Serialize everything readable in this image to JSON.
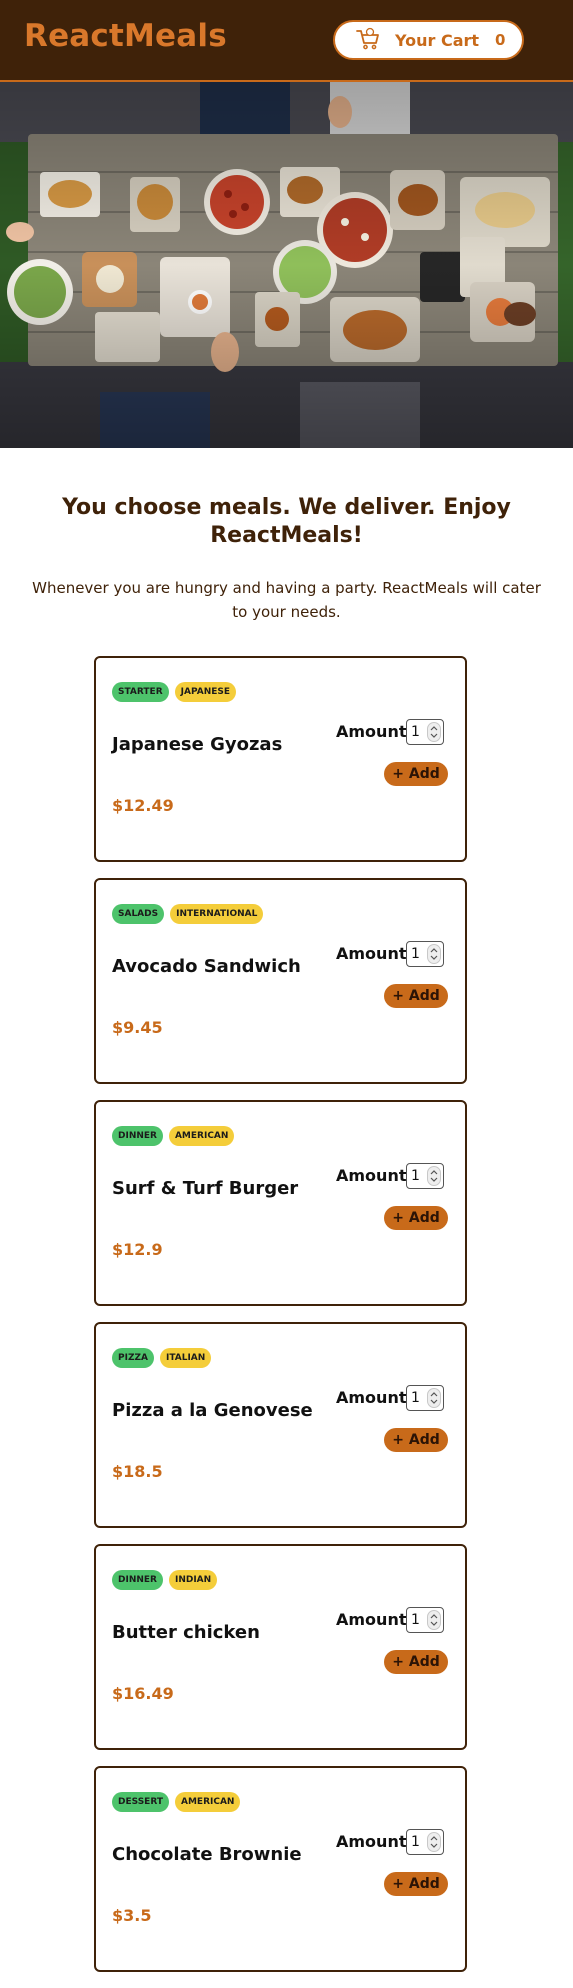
{
  "header": {
    "brand": "ReactMeals",
    "cart_label": "Your Cart",
    "cart_count": "0",
    "cart_icon": "shopping-cart-icon"
  },
  "hero": {
    "image": "food-table-hero-image"
  },
  "intro": {
    "title": "You choose meals. We deliver. Enjoy ReactMeals!",
    "text": "Whenever you are hungry and having a party. ReactMeals will cater to your needs."
  },
  "meals": [
    {
      "category": "STARTER",
      "cuisine": "JAPANESE",
      "name": "Japanese Gyozas",
      "price": "$12.49",
      "amount_label": "Amount",
      "amount": "1",
      "add_label": "+ Add"
    },
    {
      "category": "SALADS",
      "cuisine": "INTERNATIONAL",
      "name": "Avocado Sandwich",
      "price": "$9.45",
      "amount_label": "Amount",
      "amount": "1",
      "add_label": "+ Add"
    },
    {
      "category": "DINNER",
      "cuisine": "AMERICAN",
      "name": "Surf & Turf Burger",
      "price": "$12.9",
      "amount_label": "Amount",
      "amount": "1",
      "add_label": "+ Add"
    },
    {
      "category": "PIZZA",
      "cuisine": "ITALIAN",
      "name": "Pizza a la Genovese",
      "price": "$18.5",
      "amount_label": "Amount",
      "amount": "1",
      "add_label": "+ Add"
    },
    {
      "category": "DINNER",
      "cuisine": "INDIAN",
      "name": "Butter chicken",
      "price": "$16.49",
      "amount_label": "Amount",
      "amount": "1",
      "add_label": "+ Add"
    },
    {
      "category": "DESSERT",
      "cuisine": "AMERICAN",
      "name": "Chocolate Brownie",
      "price": "$3.5",
      "amount_label": "Amount",
      "amount": "1",
      "add_label": "+ Add"
    }
  ],
  "colors": {
    "header_bg": "#3f2209",
    "accent": "#c86a1a",
    "tag_category": "#4dc36b",
    "tag_cuisine": "#f4cd3a"
  }
}
